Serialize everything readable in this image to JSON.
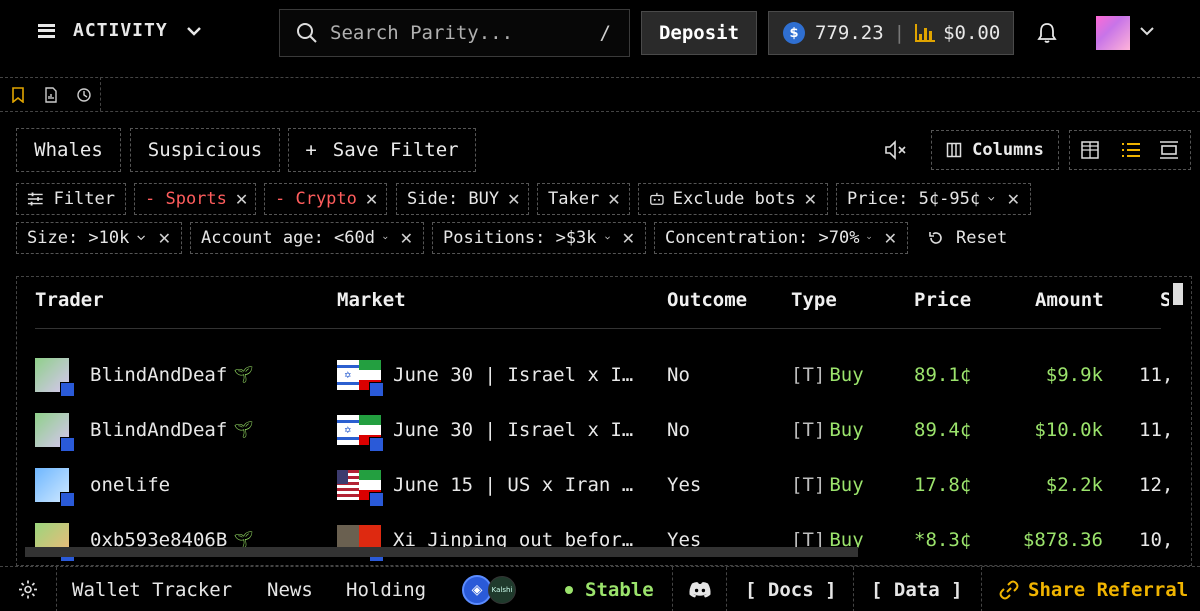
{
  "header": {
    "menu_label": "ACTIVITY",
    "search_placeholder": "Search Parity...",
    "search_shortcut": "/",
    "deposit_label": "Deposit",
    "usdc_balance": "779.23",
    "pnl_balance": "$0.00",
    "colors": {
      "usdc": "#2f6fd1",
      "pnl_bars": "#e0a400"
    }
  },
  "toolbar_icons": [
    "bookmark-icon",
    "document-chart-icon",
    "history-icon"
  ],
  "presets": {
    "whales": "Whales",
    "suspicious": "Suspicious",
    "save_filter": "Save Filter",
    "save_filter_glyph": "+"
  },
  "view_tools": {
    "columns_label": "Columns"
  },
  "filters": {
    "filter_label": "Filter",
    "chips_row1": [
      {
        "label": "- Sports",
        "negated": true
      },
      {
        "label": "- Crypto",
        "negated": true
      },
      {
        "label": "Side: BUY"
      },
      {
        "label": "Taker"
      },
      {
        "label": "Exclude bots"
      },
      {
        "label": "Price: 5¢-95¢"
      }
    ],
    "chips_row2": [
      {
        "label": "Size: >10k"
      },
      {
        "label": "Account age: <60d"
      },
      {
        "label": "Positions: >$3k"
      },
      {
        "label": "Concentration: >70%"
      }
    ],
    "reset_label": "Reset"
  },
  "table": {
    "columns": [
      "Trader",
      "Market",
      "Outcome",
      "Type",
      "Price",
      "Amount",
      "S"
    ],
    "rows": [
      {
        "trader": "BlindAndDeaf",
        "sprout": true,
        "market": "June 30 | Israel x I…",
        "outcome": "No",
        "type_tag": "[T]",
        "type": "Buy",
        "price": "89.1¢",
        "amount": "$9.9k",
        "extra": "11,",
        "avatar_colors": [
          "#8fd08a",
          "#d7c6f0"
        ],
        "market_img": "il-ir"
      },
      {
        "trader": "BlindAndDeaf",
        "sprout": true,
        "market": "June 30 | Israel x I…",
        "outcome": "No",
        "type_tag": "[T]",
        "type": "Buy",
        "price": "89.4¢",
        "amount": "$10.0k",
        "extra": "11,",
        "avatar_colors": [
          "#8fd08a",
          "#d7c6f0"
        ],
        "market_img": "il-ir"
      },
      {
        "trader": "onelife",
        "sprout": false,
        "market": "June 15 | US x Iran …",
        "outcome": "Yes",
        "type_tag": "[T]",
        "type": "Buy",
        "price": "17.8¢",
        "amount": "$2.2k",
        "extra": "12,",
        "avatar_colors": [
          "#6fb7ff",
          "#cfe8ff"
        ],
        "market_img": "us-ir"
      },
      {
        "trader": "0xb593e8406B",
        "sprout": true,
        "market": "Xi Jinping out befor…",
        "outcome": "Yes",
        "type_tag": "[T]",
        "type": "Buy",
        "price": "*8.3¢",
        "amount": "$878.36",
        "extra": "10,",
        "avatar_colors": [
          "#9bd57c",
          "#f2b97a"
        ],
        "market_img": "xi"
      }
    ]
  },
  "footer": {
    "wallet_tracker": "Wallet Tracker",
    "news": "News",
    "holding": "Holding",
    "kalshi_label": "Kalshi",
    "status": "Stable",
    "docs": "[ Docs ]",
    "data": "[ Data ]",
    "share_referral": "Share Referral",
    "colors": {
      "status": "#9be36c",
      "referral": "#f0b400"
    }
  }
}
